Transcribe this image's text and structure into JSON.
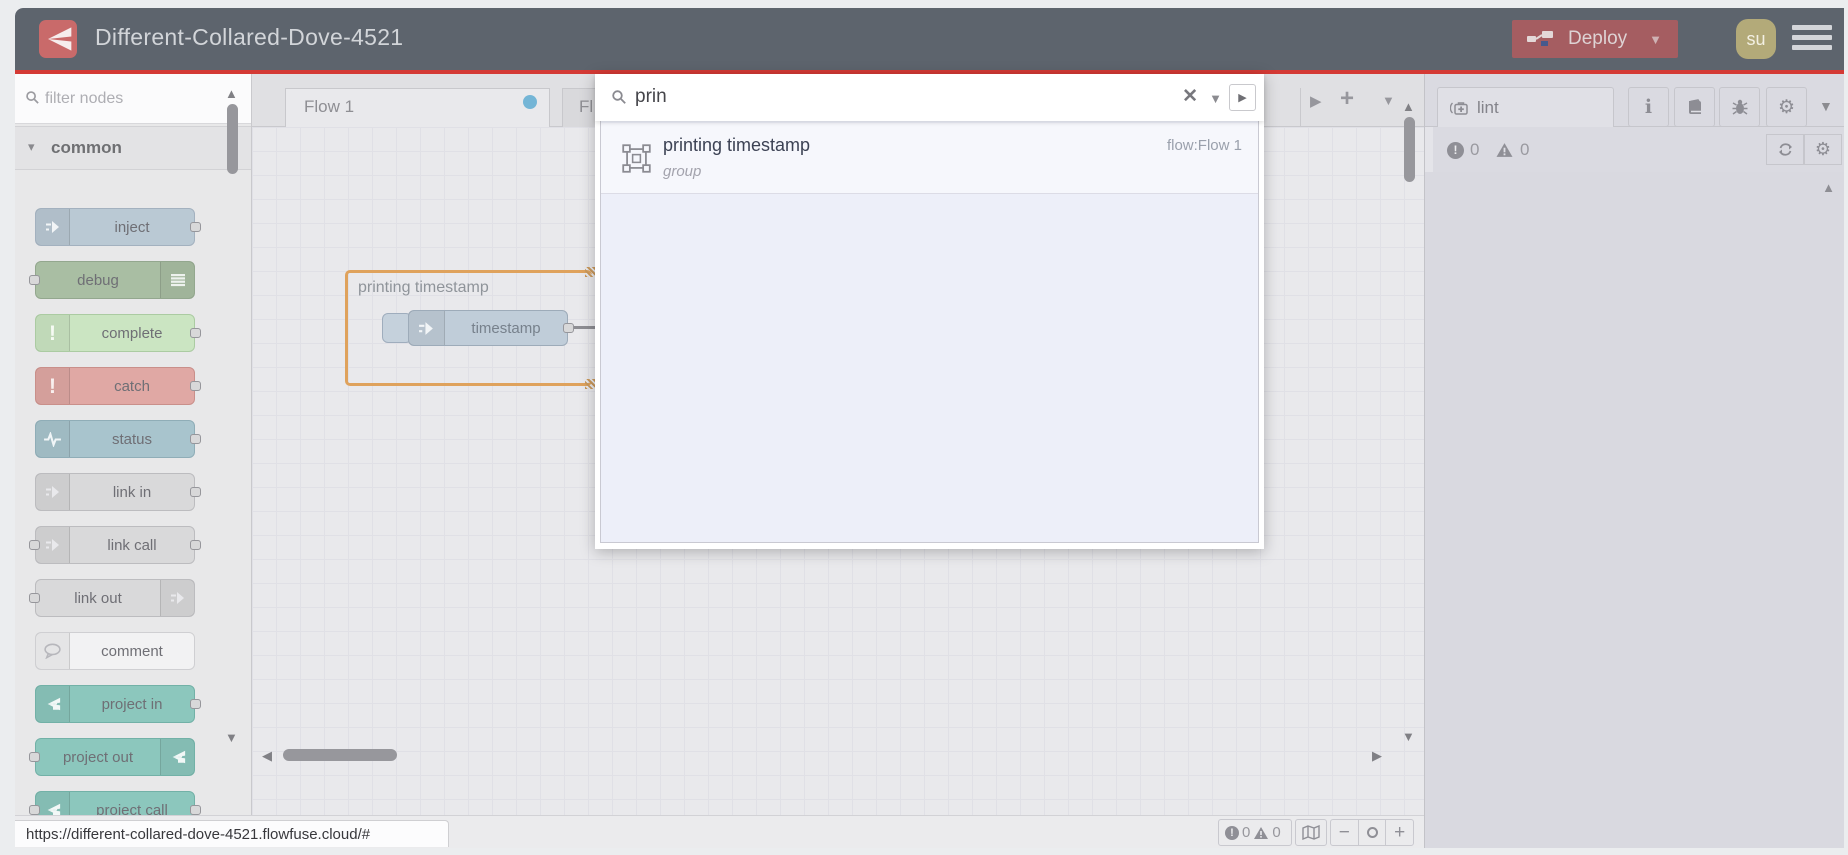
{
  "header": {
    "title": "Different-Collared-Dove-4521",
    "deploy_label": "Deploy",
    "avatar": "su"
  },
  "palette": {
    "filter_placeholder": "filter nodes",
    "category_label": "common",
    "nodes": [
      {
        "label": "inject",
        "bg": "#bac9d4",
        "border": "#a3b1bf",
        "icon": "arrow",
        "icon_color": "#f2f5f7",
        "side": "left",
        "ports": "right"
      },
      {
        "label": "debug",
        "bg": "#a9bea3",
        "border": "#93a78e",
        "icon": "lines",
        "icon_color": "#eef2ee",
        "side": "right",
        "ports": "left"
      },
      {
        "label": "complete",
        "bg": "#cbe5c2",
        "border": "#abcba2",
        "icon": "exclaim",
        "icon_color": "#f6fbf4",
        "side": "left",
        "ports": "right"
      },
      {
        "label": "catch",
        "bg": "#e0a8a4",
        "border": "#c98f8a",
        "icon": "exclaim",
        "icon_color": "#f9f0ef",
        "side": "left",
        "ports": "right"
      },
      {
        "label": "status",
        "bg": "#a8c4cd",
        "border": "#8fadb7",
        "icon": "pulse",
        "icon_color": "#f0f5f7",
        "side": "left",
        "ports": "right"
      },
      {
        "label": "link in",
        "bg": "#d9d9da",
        "border": "#bcbcbf",
        "icon": "arrow",
        "icon_color": "#e9e9ec",
        "side": "left",
        "ports": "right"
      },
      {
        "label": "link call",
        "bg": "#d9d9da",
        "border": "#bcbcbf",
        "icon": "arrow",
        "icon_color": "#e9e9ec",
        "side": "left",
        "ports": "both"
      },
      {
        "label": "link out",
        "bg": "#d9d9da",
        "border": "#bcbcbf",
        "icon": "arrow",
        "icon_color": "#e9e9ec",
        "side": "right",
        "ports": "left"
      },
      {
        "label": "comment",
        "bg": "#f2f2f3",
        "border": "#cfcfd2",
        "icon": "bubble",
        "icon_color": "#b7b7bc",
        "side": "left",
        "ports": "none"
      },
      {
        "label": "project in",
        "bg": "#8cc7bd",
        "border": "#72b1a7",
        "icon": "ff",
        "icon_color": "#f2f8f7",
        "side": "left",
        "ports": "right"
      },
      {
        "label": "project out",
        "bg": "#8cc7bd",
        "border": "#72b1a7",
        "icon": "ff",
        "icon_color": "#f2f8f7",
        "side": "right",
        "ports": "left"
      },
      {
        "label": "project call",
        "bg": "#8cc7bd",
        "border": "#72b1a7",
        "icon": "ff",
        "icon_color": "#f2f8f7",
        "side": "left",
        "ports": "both"
      }
    ]
  },
  "workspace": {
    "tab1": "Flow 1",
    "tab2_partial": "Fl",
    "group_label": "printing timestamp",
    "node_label": "timestamp"
  },
  "search": {
    "query": "prin",
    "result_title": "printing timestamp",
    "result_type": "group",
    "result_flow": "flow:Flow 1"
  },
  "sidebar": {
    "tab": "lint",
    "errors": "0",
    "warnings": "0"
  },
  "canvas_footer": {
    "errors": "0",
    "warnings": "0"
  },
  "statusbar_url": "https://different-collared-dove-4521.flowfuse.cloud/#",
  "colors": {
    "accent_red": "#d43a35",
    "deploy": "#a55d61",
    "group_border": "#dfa25c",
    "modified_dot": "#74b5d6"
  }
}
